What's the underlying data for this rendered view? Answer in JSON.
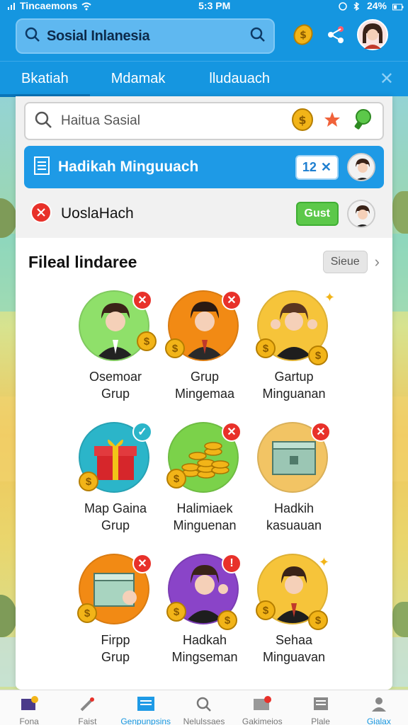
{
  "status_bar": {
    "carrier": "Tincaemons",
    "time": "5:3 PM",
    "battery": "24%"
  },
  "header": {
    "title": "Sosial Inlanesia"
  },
  "tabs": [
    {
      "label": "Bkatiah"
    },
    {
      "label": "Mdamak"
    },
    {
      "label": "lludauach"
    }
  ],
  "search": {
    "placeholder": "Haitua Sasial"
  },
  "group_row": {
    "name": "Hadikah Minguuach",
    "count": "12"
  },
  "user_row": {
    "name": "UoslaHach",
    "button": "Gust"
  },
  "section": {
    "title": "Fileal lindaree",
    "see_label": "Sieue"
  },
  "cards": [
    {
      "label": "Osemoar\nGrup"
    },
    {
      "label": "Grup\nMingemaa"
    },
    {
      "label": "Gartup\nMinguanan"
    },
    {
      "label": "Map Gaina\nGrup"
    },
    {
      "label": "Halimiaek\nMinguenan"
    },
    {
      "label": "Hadkih\nkasuauan"
    },
    {
      "label": "Firpp\nGrup"
    },
    {
      "label": "Hadkah\nMingseman"
    },
    {
      "label": "Sehaa\nMinguavan"
    }
  ],
  "bottom_nav": [
    {
      "label": "Fona"
    },
    {
      "label": "Faist"
    },
    {
      "label": "Genpunpsins"
    },
    {
      "label": "Nelulssaes"
    },
    {
      "label": "Gakimeios"
    },
    {
      "label": "Plale"
    },
    {
      "label": "Gialax"
    }
  ],
  "colors": {
    "brand": "#1596e0",
    "accent_green": "#5cc84a",
    "badge_red": "#e8312a",
    "coin": "#f2b418"
  }
}
